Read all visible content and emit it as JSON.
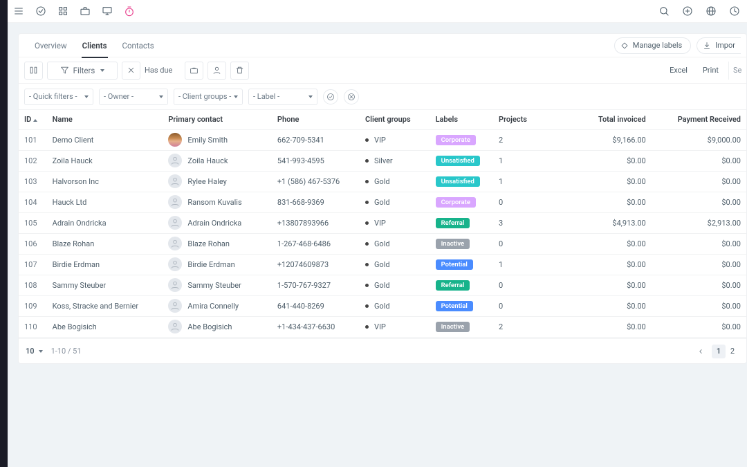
{
  "topbar": {
    "left_icons": [
      "menu-icon",
      "check-circle-icon",
      "apps-grid-icon",
      "briefcase-icon",
      "monitor-icon",
      "stopwatch-icon"
    ],
    "right_icons": [
      "search-icon",
      "plus-circle-icon",
      "globe-icon",
      "clock-icon"
    ]
  },
  "tabs": {
    "items": [
      {
        "label": "Overview",
        "active": false
      },
      {
        "label": "Clients",
        "active": true
      },
      {
        "label": "Contacts",
        "active": false
      }
    ],
    "manage_labels": "Manage labels",
    "import": "Impor"
  },
  "toolbar": {
    "filters_label": "Filters",
    "has_due": "Has due",
    "excel": "Excel",
    "print": "Print",
    "search_hint": "Se"
  },
  "dropdowns": {
    "quick_filters": "- Quick filters -",
    "owner": "- Owner -",
    "client_groups": "- Client groups -",
    "label": "- Label -"
  },
  "table": {
    "columns": [
      "ID",
      "Name",
      "Primary contact",
      "Phone",
      "Client groups",
      "Labels",
      "Projects",
      "Total invoiced",
      "Payment Received"
    ],
    "rows": [
      {
        "id": "101",
        "name": "Demo Client",
        "contact": "Emily Smith",
        "phone": "662-709-5341",
        "group": "VIP",
        "label": "Corporate",
        "projects": "2",
        "invoiced": "$9,166.00",
        "received": "$9,000.00",
        "avatar": "emily"
      },
      {
        "id": "102",
        "name": "Zoila Hauck",
        "contact": "Zoila Hauck",
        "phone": "541-993-4595",
        "group": "Silver",
        "label": "Unsatisfied",
        "projects": "1",
        "invoiced": "$0.00",
        "received": "$0.00"
      },
      {
        "id": "103",
        "name": "Halvorson Inc",
        "contact": "Rylee Haley",
        "phone": "+1 (586) 467-5376",
        "group": "Gold",
        "label": "Unsatisfied",
        "projects": "1",
        "invoiced": "$0.00",
        "received": "$0.00"
      },
      {
        "id": "104",
        "name": "Hauck Ltd",
        "contact": "Ransom Kuvalis",
        "phone": "831-668-9369",
        "group": "Gold",
        "label": "Corporate",
        "projects": "0",
        "invoiced": "$0.00",
        "received": "$0.00"
      },
      {
        "id": "105",
        "name": "Adrain Ondricka",
        "contact": "Adrain Ondricka",
        "phone": "+13807893966",
        "group": "VIP",
        "label": "Referral",
        "projects": "3",
        "invoiced": "$4,913.00",
        "received": "$2,913.00"
      },
      {
        "id": "106",
        "name": "Blaze Rohan",
        "contact": "Blaze Rohan",
        "phone": "1-267-468-6486",
        "group": "Gold",
        "label": "Inactive",
        "projects": "0",
        "invoiced": "$0.00",
        "received": "$0.00"
      },
      {
        "id": "107",
        "name": "Birdie Erdman",
        "contact": "Birdie Erdman",
        "phone": "+12074609873",
        "group": "Gold",
        "label": "Potential",
        "projects": "1",
        "invoiced": "$0.00",
        "received": "$0.00"
      },
      {
        "id": "108",
        "name": "Sammy Steuber",
        "contact": "Sammy Steuber",
        "phone": "1-570-767-9327",
        "group": "Gold",
        "label": "Referral",
        "projects": "0",
        "invoiced": "$0.00",
        "received": "$0.00"
      },
      {
        "id": "109",
        "name": "Koss, Stracke and Bernier",
        "contact": "Amira Connelly",
        "phone": "641-440-8269",
        "group": "Gold",
        "label": "Potential",
        "projects": "0",
        "invoiced": "$0.00",
        "received": "$0.00"
      },
      {
        "id": "110",
        "name": "Abe Bogisich",
        "contact": "Abe Bogisich",
        "phone": "+1-434-437-6630",
        "group": "VIP",
        "label": "Inactive",
        "projects": "2",
        "invoiced": "$0.00",
        "received": "$0.00"
      }
    ]
  },
  "footer": {
    "page_size": "10",
    "range": "1-10 / 51",
    "pages": [
      "1",
      "2"
    ],
    "active_page": "1"
  }
}
